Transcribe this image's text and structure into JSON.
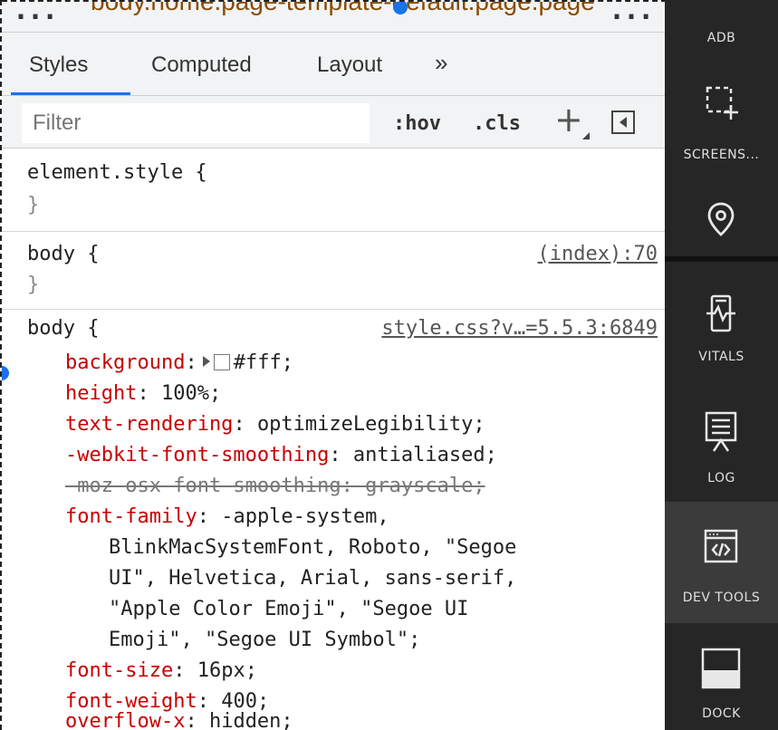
{
  "breadcrumb": {
    "text": "body.home.page-template-default.page.page",
    "leading": "...",
    "trailing": "..."
  },
  "tabs": [
    {
      "label": "Styles",
      "active": true
    },
    {
      "label": "Computed",
      "active": false
    },
    {
      "label": "Layout",
      "active": false
    }
  ],
  "tabs_more": "»",
  "filter": {
    "placeholder": "Filter",
    "hov": ":hov",
    "cls": ".cls",
    "plus": "+"
  },
  "rules": {
    "element_style": {
      "selector": "element.style {",
      "close": "}"
    },
    "body_index": {
      "selector": "body {",
      "close": "}",
      "source": "(index):70"
    },
    "body_main": {
      "selector": "body {",
      "source": "style.css?v…=5.5.3:6849",
      "background": {
        "prop": "background",
        "value": "#fff"
      },
      "decls": [
        {
          "prop": "height",
          "value": "100%;"
        },
        {
          "prop": "text-rendering",
          "value": "optimizeLegibility;"
        },
        {
          "prop": "-webkit-font-smoothing",
          "value": "antialiased;"
        }
      ],
      "struck": "-moz-osx-font-smoothing: grayscale;",
      "font_family": {
        "prop": "font-family",
        "line1": "-apple-system,",
        "line2": "BlinkMacSystemFont, Roboto, \"Segoe",
        "line3": "UI\", Helvetica, Arial, sans-serif,",
        "line4": "\"Apple Color Emoji\", \"Segoe UI",
        "line5": "Emoji\", \"Segoe UI Symbol\";"
      },
      "tail_decls": [
        {
          "prop": "font-size",
          "value": "16px;"
        },
        {
          "prop": "font-weight",
          "value": "400;"
        },
        {
          "prop": "overflow-x",
          "value": "hidden;"
        }
      ]
    }
  },
  "sidebar": {
    "items": [
      {
        "label": "ADB",
        "icon": "adb"
      },
      {
        "label": "SCREENS...",
        "icon": "screenshot-icon"
      },
      {
        "label": "",
        "icon": "location-pin-icon"
      },
      {
        "label": "VITALS",
        "icon": "vitals-icon"
      },
      {
        "label": "LOG",
        "icon": "log-icon"
      },
      {
        "label": "DEV TOOLS",
        "icon": "dev-tools-icon",
        "active": true
      },
      {
        "label": "DOCK",
        "icon": "dock-icon"
      }
    ]
  },
  "colors": {
    "accent": "#1a73e8",
    "property": "#c80000",
    "sidebar_bg": "#262626"
  }
}
